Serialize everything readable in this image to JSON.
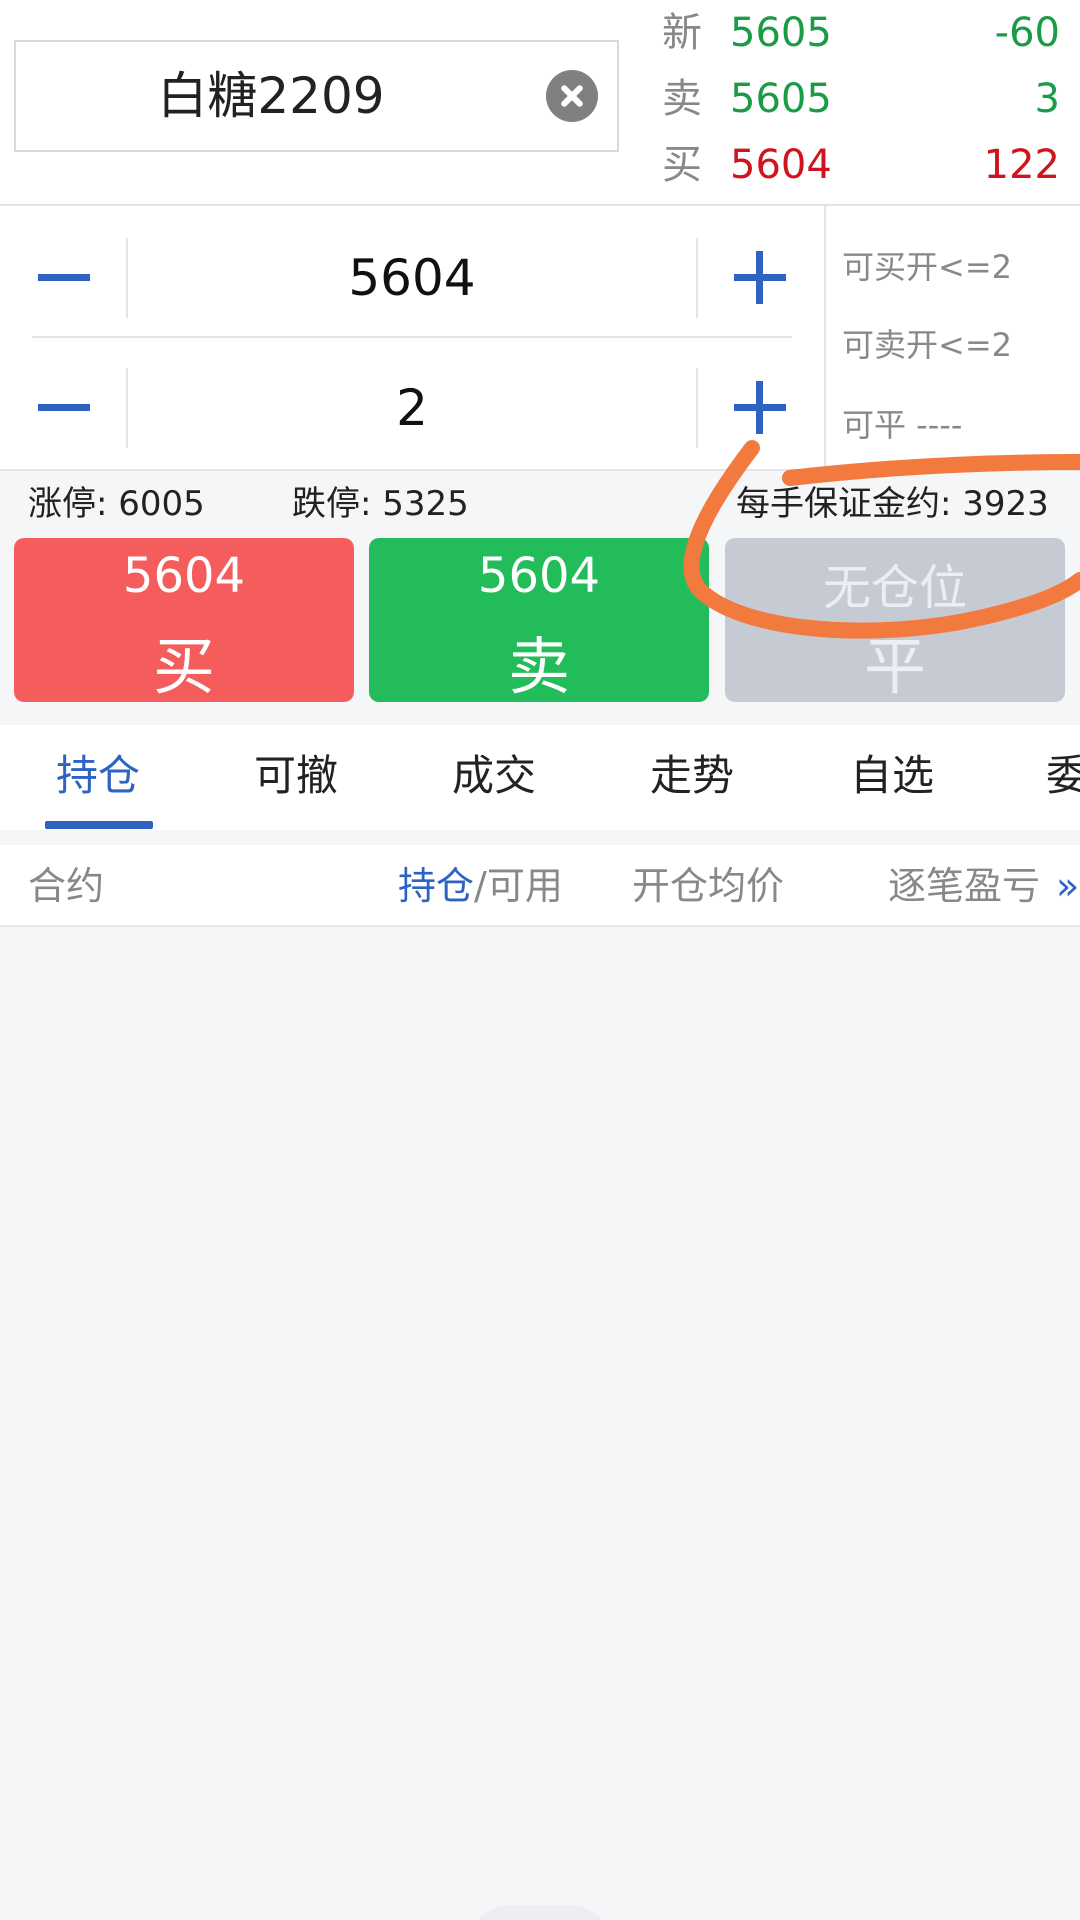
{
  "contract": {
    "name": "白糖2209"
  },
  "quotes": [
    {
      "label": "新",
      "price": "5605",
      "change": "-60",
      "color": "#1a9b45"
    },
    {
      "label": "卖",
      "price": "5605",
      "change": "3",
      "color": "#1a9b45"
    },
    {
      "label": "买",
      "price": "5604",
      "change": "122",
      "color": "#d0141f"
    }
  ],
  "order": {
    "price": "5604",
    "quantity": "2"
  },
  "availability": {
    "buy_open": "可买开<=2",
    "sell_open": "可卖开<=2",
    "close": "可平 ----"
  },
  "limits": {
    "up": "涨停: 6005",
    "down": "跌停: 5325",
    "margin": "每手保证金约: 3923"
  },
  "buttons": {
    "buy": {
      "price": "5604",
      "label": "买"
    },
    "sell": {
      "price": "5604",
      "label": "卖"
    },
    "close": {
      "price": "无仓位",
      "label": "平"
    }
  },
  "tabs": [
    {
      "label": "持仓",
      "active": true
    },
    {
      "label": "可撤"
    },
    {
      "label": "成交"
    },
    {
      "label": "走势"
    },
    {
      "label": "自选"
    },
    {
      "label": "委"
    }
  ],
  "table": {
    "headers": {
      "contract": "合约",
      "position_part1": "持仓",
      "position_part2": "/可用",
      "avg_price": "开仓均价",
      "pnl": "逐笔盈亏",
      "more": "»"
    }
  },
  "colors": {
    "accent": "#2f63c2",
    "buy": "#f55d5d",
    "sell": "#22bd5a",
    "disabled": "#c6cbd3",
    "annotation": "#f37a3f"
  }
}
